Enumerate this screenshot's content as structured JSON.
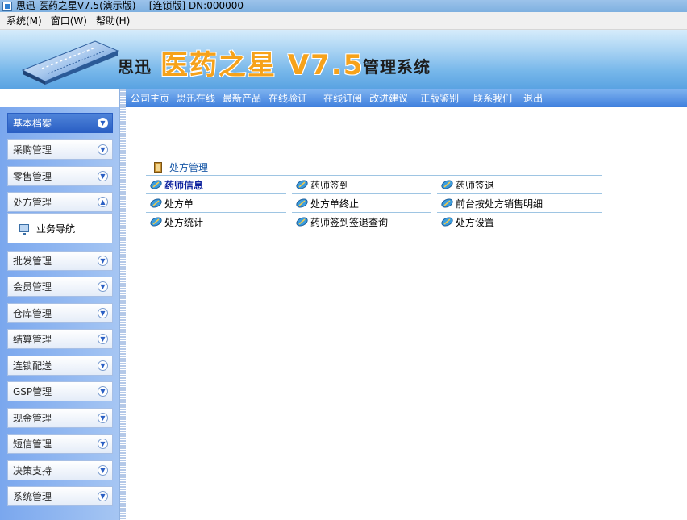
{
  "window": {
    "title": "思迅 医药之星V7.5(演示版) -- [连锁版] DN:000000"
  },
  "menu": [
    "系统(M)",
    "窗口(W)",
    "帮助(H)"
  ],
  "banner": {
    "brand_a": "思迅",
    "brand_b": "医药之星 V7.5",
    "brand_c": "管理系统"
  },
  "nav": [
    "公司主页",
    "思迅在线",
    "最新产品",
    "在线验证",
    "在线订阅",
    "改进建议",
    "正版鉴别",
    "联系我们",
    "退出"
  ],
  "sidebar": {
    "items": [
      "基本档案",
      "采购管理",
      "零售管理",
      "处方管理",
      "批发管理",
      "会员管理",
      "仓库管理",
      "结算管理",
      "连锁配送",
      "GSP管理",
      "现金管理",
      "短信管理",
      "决策支持",
      "系统管理"
    ],
    "active": "基本档案",
    "expanded": "处方管理",
    "subitem": "业务导航"
  },
  "content": {
    "section_title": "处方管理",
    "rows": [
      [
        "药师信息",
        "药师签到",
        "药师签退"
      ],
      [
        "处方单",
        "处方单终止",
        "前台按处方销售明细"
      ],
      [
        "处方统计",
        "药师签到签退查询",
        "处方设置"
      ]
    ],
    "selected": "药师信息"
  },
  "colors": {
    "accent": "#2a5fc4",
    "banner_title": "#f6a21a",
    "sidebar_bg": "#7aa7ee"
  }
}
